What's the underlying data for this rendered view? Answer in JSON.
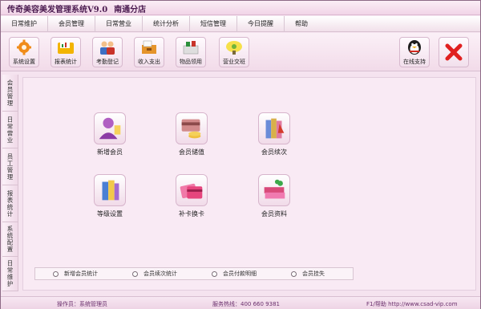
{
  "window": {
    "title": "传奇美容美发管理系统V9.0",
    "branch": "南通分店"
  },
  "menu": [
    "日常维护",
    "会员管理",
    "日常营业",
    "统计分析",
    "短信管理",
    "今日提醒",
    "帮助"
  ],
  "toolbar": {
    "buttons": [
      {
        "label": "系统设置",
        "icon": "gear-icon"
      },
      {
        "label": "报表统计",
        "icon": "folder-chart-icon"
      },
      {
        "label": "考勤登记",
        "icon": "staff-icon"
      },
      {
        "label": "收入支出",
        "icon": "cash-box-icon"
      },
      {
        "label": "物品领用",
        "icon": "goods-icon"
      },
      {
        "label": "营业交班",
        "icon": "shift-icon"
      }
    ],
    "support_label": "在线支持",
    "close_icon": "close-icon"
  },
  "side_nav": [
    "会员管理",
    "日常营业",
    "员工管理",
    "报表统计",
    "系统配置",
    "日常维护"
  ],
  "main": {
    "functions": [
      {
        "label": "新增会员",
        "icon": "new-member-icon"
      },
      {
        "label": "会员储值",
        "icon": "member-deposit-icon"
      },
      {
        "label": "会员续次",
        "icon": "member-renew-icon"
      },
      {
        "label": "等级设置",
        "icon": "level-settings-icon"
      },
      {
        "label": "补卡换卡",
        "icon": "card-replace-icon"
      },
      {
        "label": "会员资料",
        "icon": "member-profile-icon"
      }
    ],
    "stats_options": [
      "新增会员统计",
      "会员续次统计",
      "会员付款明细",
      "会员挂失"
    ]
  },
  "status": {
    "operator": "操作员：系统管理员",
    "hotline": "服务热线：400 660 9381",
    "help": "F1/帮助 http://www.csad-vip.com"
  },
  "colors": {
    "background": "#f5e3ef",
    "accent": "#6a2f6c",
    "close": "#e02020"
  }
}
